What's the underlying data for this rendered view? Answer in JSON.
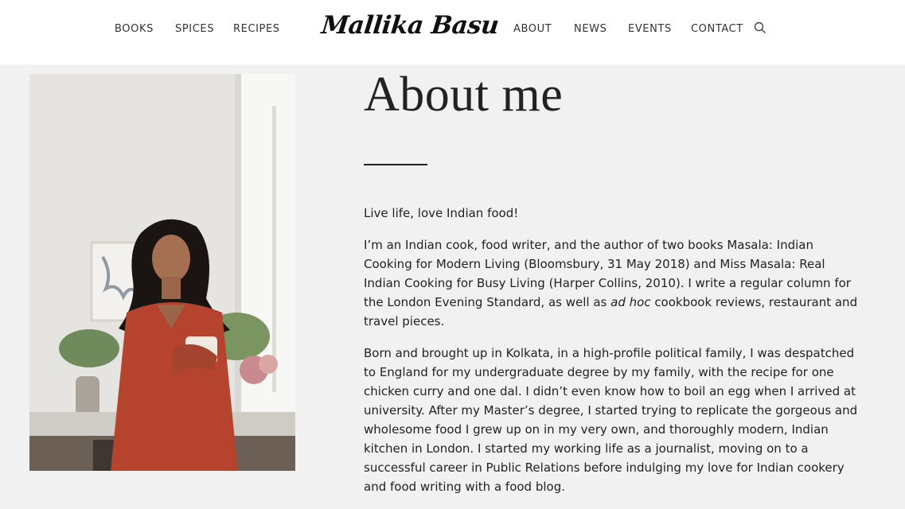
{
  "header": {
    "logo": "Mallika Basu",
    "nav_left": [
      "BOOKS",
      "SPICES",
      "RECIPES"
    ],
    "nav_right": [
      "ABOUT",
      "NEWS",
      "EVENTS",
      "CONTACT"
    ]
  },
  "page": {
    "title": "About me",
    "tagline": "Live life, love Indian food!",
    "p1_before": "I’m an Indian cook, food writer, and the author of two books Masala: Indian Cooking for Modern Living (Bloomsbury, 31 May 2018) and Miss Masala: Real Indian Cooking for Busy Living (Harper Collins, 2010). I write a regular column for the London Evening Standard, as well as ",
    "p1_em": "ad hoc",
    "p1_after": " cookbook reviews, restaurant and travel pieces.",
    "p2": "Born and brought up in Kolkata, in a high-profile political family, I was despatched to England for my undergraduate degree by my family, with the recipe for one chicken curry and one dal. I didn’t even know how to boil an egg when I arrived at university. After my Master’s degree, I started trying to replicate the gorgeous and wholesome food I grew up on in my very own, and thoroughly modern, Indian kitchen in London. I started my working life as a journalist, moving on to a successful career in Public Relations before indulging my love for Indian cookery and food writing with a food blog."
  },
  "colors": {
    "background": "#f1f1f1",
    "header": "#ffffff",
    "text": "#222222",
    "dress": "#b5432e"
  }
}
